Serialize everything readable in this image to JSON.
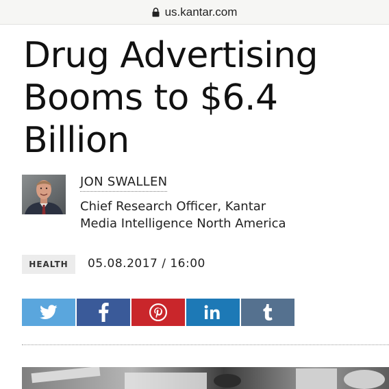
{
  "browser": {
    "url": "us.kantar.com",
    "lock_icon": "lock-icon"
  },
  "article": {
    "headline_lines": [
      "Drug Advertising",
      "Booms to $6.4",
      "Billion"
    ],
    "author": {
      "name": "JON SWALLEN",
      "title_lines": [
        "Chief Research Officer, Kantar",
        "Media Intelligence North America"
      ]
    },
    "category": "HEALTH",
    "published": "05.08.2017 / 16:00"
  },
  "share": [
    {
      "network": "twitter",
      "icon": "twitter-icon",
      "color": "#5aa6dd"
    },
    {
      "network": "facebook",
      "icon": "facebook-icon",
      "color": "#3a5a99"
    },
    {
      "network": "pinterest",
      "icon": "pinterest-icon",
      "color": "#c9262b"
    },
    {
      "network": "linkedin",
      "icon": "linkedin-icon",
      "color": "#1d79b6"
    },
    {
      "network": "tumblr",
      "icon": "tumblr-icon",
      "color": "#55718f"
    }
  ]
}
